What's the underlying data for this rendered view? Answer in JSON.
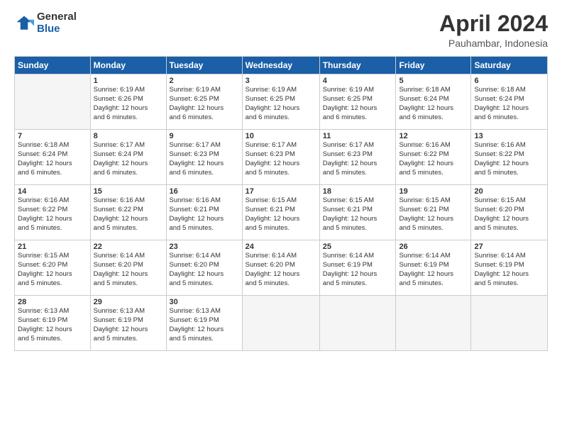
{
  "logo": {
    "general": "General",
    "blue": "Blue"
  },
  "header": {
    "title": "April 2024",
    "subtitle": "Pauhambar, Indonesia"
  },
  "days_of_week": [
    "Sunday",
    "Monday",
    "Tuesday",
    "Wednesday",
    "Thursday",
    "Friday",
    "Saturday"
  ],
  "weeks": [
    [
      {
        "day": "",
        "sunrise": "",
        "sunset": "",
        "daylight": ""
      },
      {
        "day": "1",
        "sunrise": "Sunrise: 6:19 AM",
        "sunset": "Sunset: 6:26 PM",
        "daylight": "Daylight: 12 hours and 6 minutes."
      },
      {
        "day": "2",
        "sunrise": "Sunrise: 6:19 AM",
        "sunset": "Sunset: 6:25 PM",
        "daylight": "Daylight: 12 hours and 6 minutes."
      },
      {
        "day": "3",
        "sunrise": "Sunrise: 6:19 AM",
        "sunset": "Sunset: 6:25 PM",
        "daylight": "Daylight: 12 hours and 6 minutes."
      },
      {
        "day": "4",
        "sunrise": "Sunrise: 6:19 AM",
        "sunset": "Sunset: 6:25 PM",
        "daylight": "Daylight: 12 hours and 6 minutes."
      },
      {
        "day": "5",
        "sunrise": "Sunrise: 6:18 AM",
        "sunset": "Sunset: 6:24 PM",
        "daylight": "Daylight: 12 hours and 6 minutes."
      },
      {
        "day": "6",
        "sunrise": "Sunrise: 6:18 AM",
        "sunset": "Sunset: 6:24 PM",
        "daylight": "Daylight: 12 hours and 6 minutes."
      }
    ],
    [
      {
        "day": "7",
        "sunrise": "Sunrise: 6:18 AM",
        "sunset": "Sunset: 6:24 PM",
        "daylight": "Daylight: 12 hours and 6 minutes."
      },
      {
        "day": "8",
        "sunrise": "Sunrise: 6:17 AM",
        "sunset": "Sunset: 6:24 PM",
        "daylight": "Daylight: 12 hours and 6 minutes."
      },
      {
        "day": "9",
        "sunrise": "Sunrise: 6:17 AM",
        "sunset": "Sunset: 6:23 PM",
        "daylight": "Daylight: 12 hours and 6 minutes."
      },
      {
        "day": "10",
        "sunrise": "Sunrise: 6:17 AM",
        "sunset": "Sunset: 6:23 PM",
        "daylight": "Daylight: 12 hours and 5 minutes."
      },
      {
        "day": "11",
        "sunrise": "Sunrise: 6:17 AM",
        "sunset": "Sunset: 6:23 PM",
        "daylight": "Daylight: 12 hours and 5 minutes."
      },
      {
        "day": "12",
        "sunrise": "Sunrise: 6:16 AM",
        "sunset": "Sunset: 6:22 PM",
        "daylight": "Daylight: 12 hours and 5 minutes."
      },
      {
        "day": "13",
        "sunrise": "Sunrise: 6:16 AM",
        "sunset": "Sunset: 6:22 PM",
        "daylight": "Daylight: 12 hours and 5 minutes."
      }
    ],
    [
      {
        "day": "14",
        "sunrise": "Sunrise: 6:16 AM",
        "sunset": "Sunset: 6:22 PM",
        "daylight": "Daylight: 12 hours and 5 minutes."
      },
      {
        "day": "15",
        "sunrise": "Sunrise: 6:16 AM",
        "sunset": "Sunset: 6:22 PM",
        "daylight": "Daylight: 12 hours and 5 minutes."
      },
      {
        "day": "16",
        "sunrise": "Sunrise: 6:16 AM",
        "sunset": "Sunset: 6:21 PM",
        "daylight": "Daylight: 12 hours and 5 minutes."
      },
      {
        "day": "17",
        "sunrise": "Sunrise: 6:15 AM",
        "sunset": "Sunset: 6:21 PM",
        "daylight": "Daylight: 12 hours and 5 minutes."
      },
      {
        "day": "18",
        "sunrise": "Sunrise: 6:15 AM",
        "sunset": "Sunset: 6:21 PM",
        "daylight": "Daylight: 12 hours and 5 minutes."
      },
      {
        "day": "19",
        "sunrise": "Sunrise: 6:15 AM",
        "sunset": "Sunset: 6:21 PM",
        "daylight": "Daylight: 12 hours and 5 minutes."
      },
      {
        "day": "20",
        "sunrise": "Sunrise: 6:15 AM",
        "sunset": "Sunset: 6:20 PM",
        "daylight": "Daylight: 12 hours and 5 minutes."
      }
    ],
    [
      {
        "day": "21",
        "sunrise": "Sunrise: 6:15 AM",
        "sunset": "Sunset: 6:20 PM",
        "daylight": "Daylight: 12 hours and 5 minutes."
      },
      {
        "day": "22",
        "sunrise": "Sunrise: 6:14 AM",
        "sunset": "Sunset: 6:20 PM",
        "daylight": "Daylight: 12 hours and 5 minutes."
      },
      {
        "day": "23",
        "sunrise": "Sunrise: 6:14 AM",
        "sunset": "Sunset: 6:20 PM",
        "daylight": "Daylight: 12 hours and 5 minutes."
      },
      {
        "day": "24",
        "sunrise": "Sunrise: 6:14 AM",
        "sunset": "Sunset: 6:20 PM",
        "daylight": "Daylight: 12 hours and 5 minutes."
      },
      {
        "day": "25",
        "sunrise": "Sunrise: 6:14 AM",
        "sunset": "Sunset: 6:19 PM",
        "daylight": "Daylight: 12 hours and 5 minutes."
      },
      {
        "day": "26",
        "sunrise": "Sunrise: 6:14 AM",
        "sunset": "Sunset: 6:19 PM",
        "daylight": "Daylight: 12 hours and 5 minutes."
      },
      {
        "day": "27",
        "sunrise": "Sunrise: 6:14 AM",
        "sunset": "Sunset: 6:19 PM",
        "daylight": "Daylight: 12 hours and 5 minutes."
      }
    ],
    [
      {
        "day": "28",
        "sunrise": "Sunrise: 6:13 AM",
        "sunset": "Sunset: 6:19 PM",
        "daylight": "Daylight: 12 hours and 5 minutes."
      },
      {
        "day": "29",
        "sunrise": "Sunrise: 6:13 AM",
        "sunset": "Sunset: 6:19 PM",
        "daylight": "Daylight: 12 hours and 5 minutes."
      },
      {
        "day": "30",
        "sunrise": "Sunrise: 6:13 AM",
        "sunset": "Sunset: 6:19 PM",
        "daylight": "Daylight: 12 hours and 5 minutes."
      },
      {
        "day": "",
        "sunrise": "",
        "sunset": "",
        "daylight": ""
      },
      {
        "day": "",
        "sunrise": "",
        "sunset": "",
        "daylight": ""
      },
      {
        "day": "",
        "sunrise": "",
        "sunset": "",
        "daylight": ""
      },
      {
        "day": "",
        "sunrise": "",
        "sunset": "",
        "daylight": ""
      }
    ]
  ]
}
